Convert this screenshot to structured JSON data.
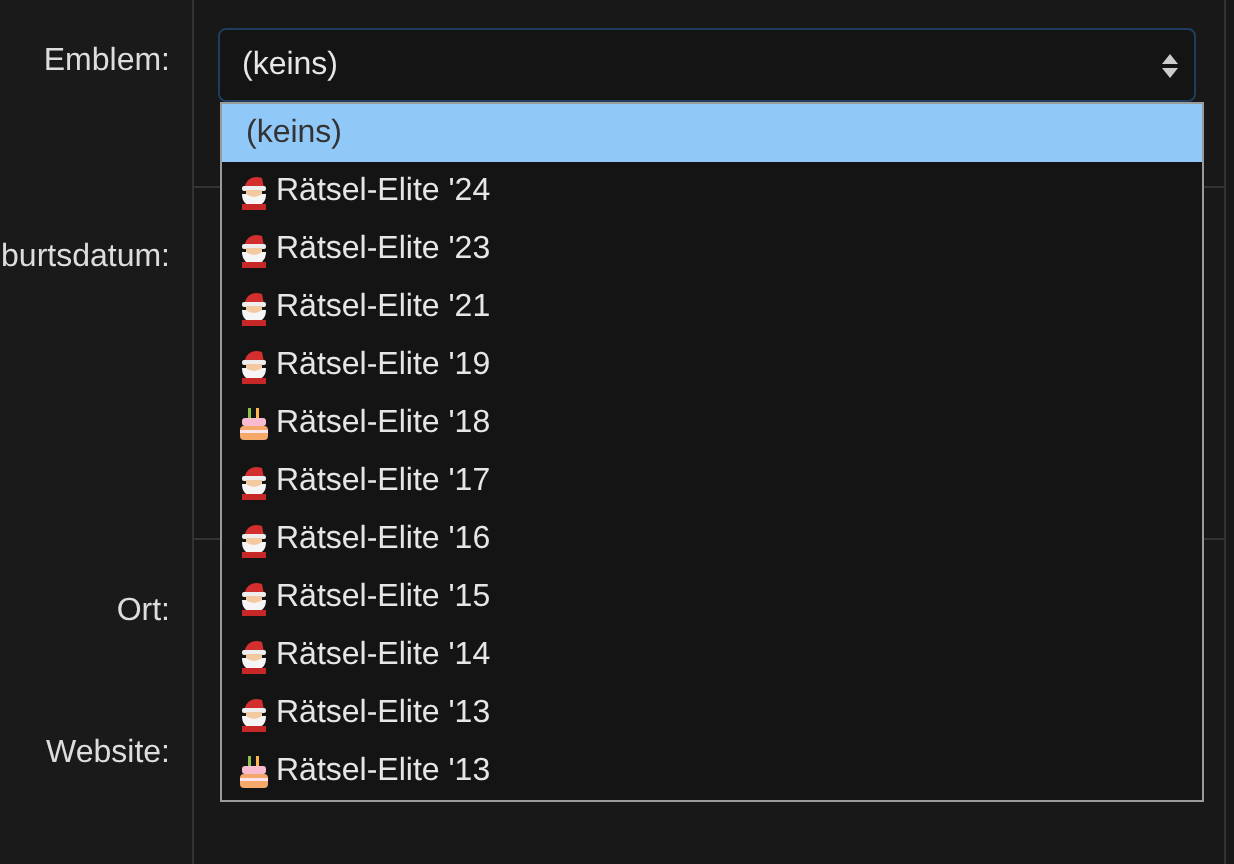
{
  "fields": [
    {
      "label": "Emblem:"
    },
    {
      "label": "burtsdatum:"
    },
    {
      "label": "Ort:"
    },
    {
      "label": "Website:"
    }
  ],
  "emblem_select": {
    "value": "(keins)",
    "open": true,
    "options": [
      {
        "label": "(keins)",
        "kind": "none",
        "selected": true
      },
      {
        "label": "Rätsel-Elite '24",
        "kind": "santa",
        "selected": false
      },
      {
        "label": "Rätsel-Elite '23",
        "kind": "santa",
        "selected": false
      },
      {
        "label": "Rätsel-Elite '21",
        "kind": "santa",
        "selected": false
      },
      {
        "label": "Rätsel-Elite '19",
        "kind": "santa",
        "selected": false
      },
      {
        "label": "Rätsel-Elite '18",
        "kind": "cake",
        "selected": false
      },
      {
        "label": "Rätsel-Elite '17",
        "kind": "santa",
        "selected": false
      },
      {
        "label": "Rätsel-Elite '16",
        "kind": "santa",
        "selected": false
      },
      {
        "label": "Rätsel-Elite '15",
        "kind": "santa",
        "selected": false
      },
      {
        "label": "Rätsel-Elite '14",
        "kind": "santa",
        "selected": false
      },
      {
        "label": "Rätsel-Elite '13",
        "kind": "santa",
        "selected": false
      },
      {
        "label": "Rätsel-Elite '13",
        "kind": "cake",
        "selected": false
      }
    ]
  }
}
